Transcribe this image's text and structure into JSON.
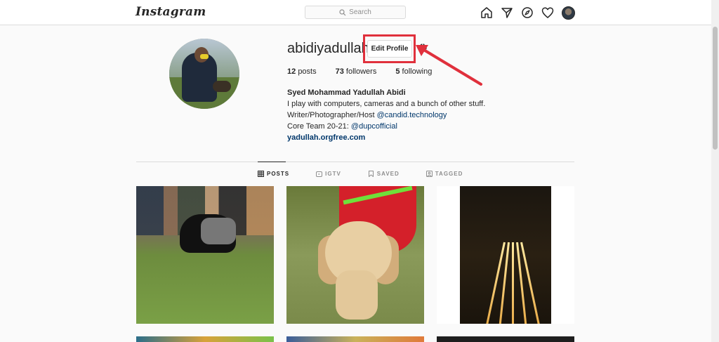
{
  "app": {
    "logo": "Instagram"
  },
  "search": {
    "placeholder": "Search"
  },
  "nav": {
    "icons": [
      "home-icon",
      "direct-icon",
      "explore-icon",
      "heart-icon",
      "profile-avatar"
    ]
  },
  "profile": {
    "username": "abidiyadullah",
    "edit_label": "Edit Profile",
    "stats": {
      "posts_count": "12",
      "posts_label": "posts",
      "followers_count": "73",
      "followers_label": "followers",
      "following_count": "5",
      "following_label": "following"
    },
    "bio": {
      "full_name": "Syed Mohammad Yadullah Abidi",
      "line1": "I play with computers, cameras and a bunch of other stuff.",
      "line2_text": "Writer/Photographer/Host ",
      "line2_mention": "@candid.technology",
      "line3_text": "Core Team 20-21: ",
      "line3_mention": "@dupcofficial",
      "website": "yadullah.orgfree.com"
    }
  },
  "tabs": [
    {
      "label": "POSTS",
      "icon": "grid-icon",
      "active": true
    },
    {
      "label": "IGTV",
      "icon": "igtv-icon",
      "active": false
    },
    {
      "label": "SAVED",
      "icon": "bookmark-icon",
      "active": false
    },
    {
      "label": "TAGGED",
      "icon": "tag-icon",
      "active": false
    }
  ],
  "colors": {
    "highlight": "#e0303c",
    "link": "#00376b",
    "border": "#dbdbdb",
    "background": "#fafafa"
  }
}
